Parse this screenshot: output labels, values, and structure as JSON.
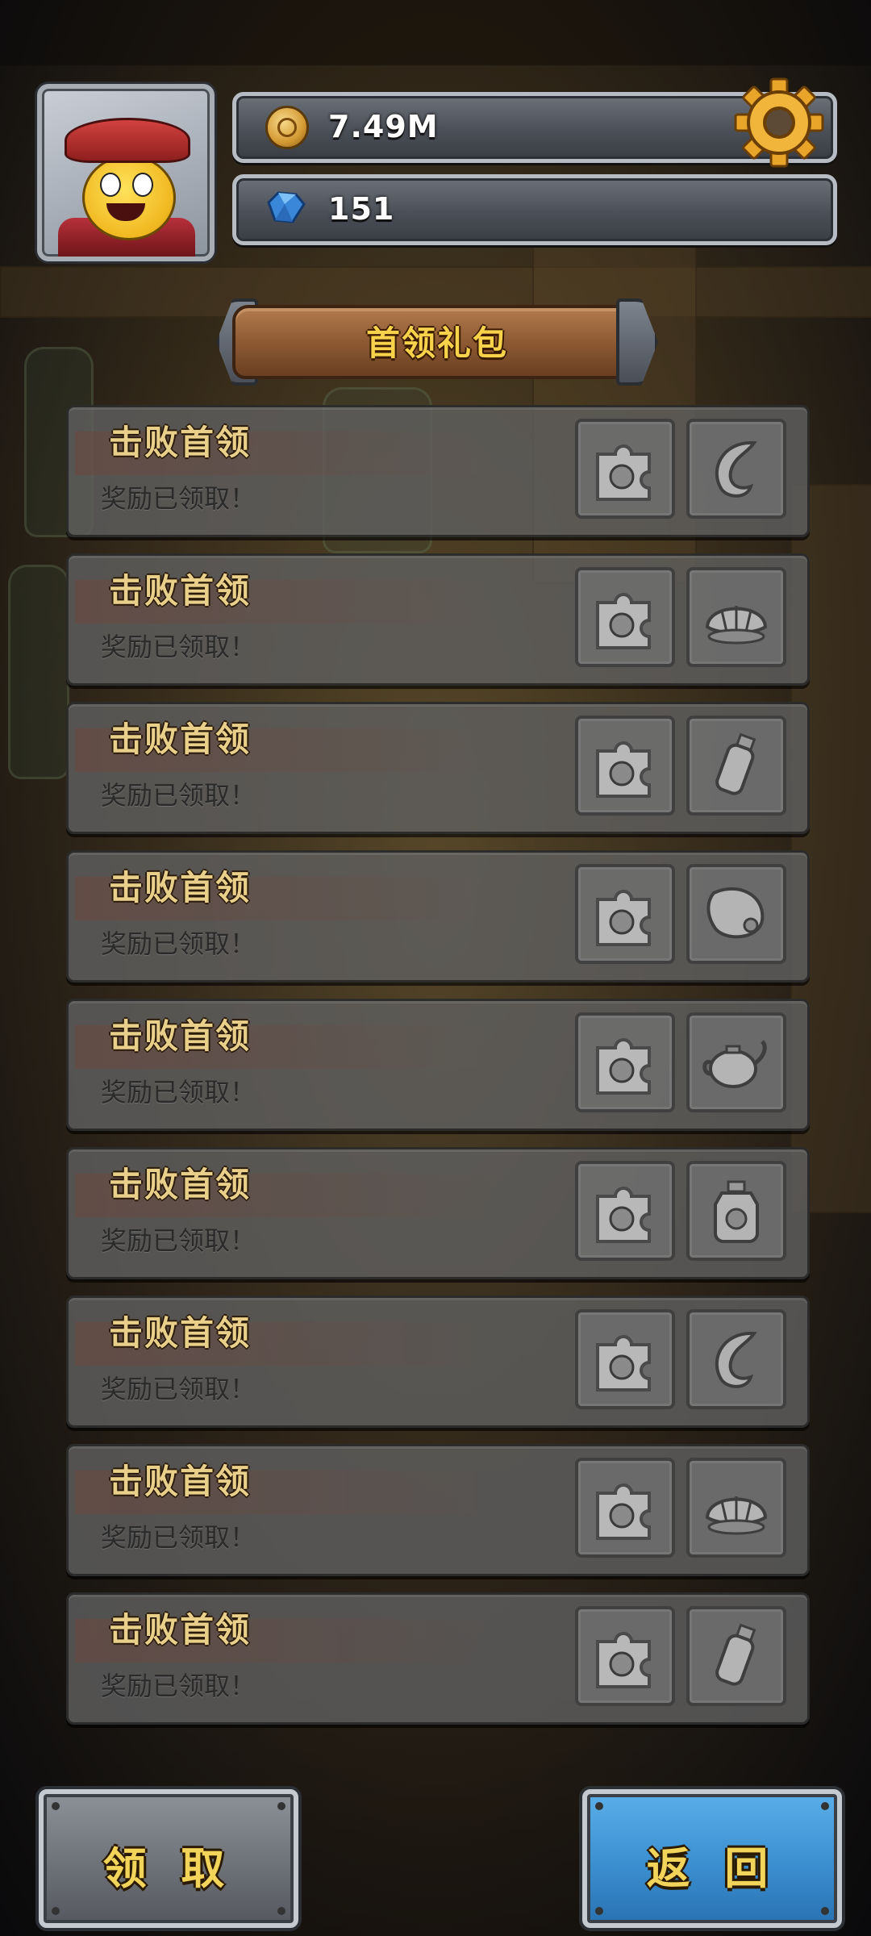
{
  "header": {
    "avatar_name": "player-avatar",
    "coins": "7.49M",
    "gems": "151"
  },
  "panel": {
    "title": "首领礼包"
  },
  "rows": [
    {
      "title": "击败首领",
      "status": "奖励已领取！",
      "reward1": "puzzle-piece-icon",
      "reward2": "horn-icon"
    },
    {
      "title": "击败首领",
      "status": "奖励已领取！",
      "reward1": "puzzle-piece-icon",
      "reward2": "shell-icon"
    },
    {
      "title": "击败首领",
      "status": "奖励已领取！",
      "reward1": "puzzle-piece-icon",
      "reward2": "bottle-icon"
    },
    {
      "title": "击败首领",
      "status": "奖励已领取！",
      "reward1": "puzzle-piece-icon",
      "reward2": "meat-icon"
    },
    {
      "title": "击败首领",
      "status": "奖励已领取！",
      "reward1": "puzzle-piece-icon",
      "reward2": "teapot-icon"
    },
    {
      "title": "击败首领",
      "status": "奖励已领取！",
      "reward1": "puzzle-piece-icon",
      "reward2": "potion-jar-icon"
    },
    {
      "title": "击败首领",
      "status": "奖励已领取！",
      "reward1": "puzzle-piece-icon",
      "reward2": "horn-icon"
    },
    {
      "title": "击败首领",
      "status": "奖励已领取！",
      "reward1": "puzzle-piece-icon",
      "reward2": "shell-icon"
    },
    {
      "title": "击败首领",
      "status": "奖励已领取！",
      "reward1": "puzzle-piece-icon",
      "reward2": "bottle-icon"
    }
  ],
  "buttons": {
    "claim": "领 取",
    "back": "返 回"
  },
  "colors": {
    "gold_text": "#f3d45a",
    "back_button": "#3b8fd0",
    "claim_button": "#6b6f76"
  }
}
